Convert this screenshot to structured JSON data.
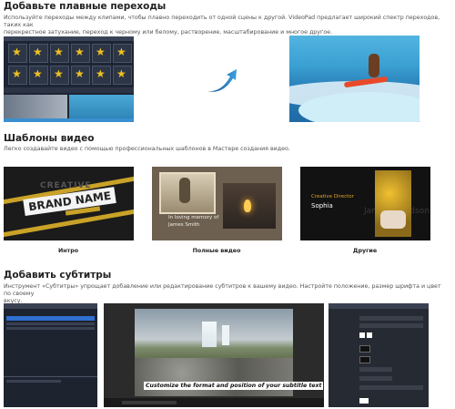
{
  "sections": [
    {
      "title": "Добавьте плавные переходы",
      "desc_lines": [
        "Используйте переходы между клипами, чтобы плавно переходить от одной сцены к другой. VideoPad предлагает широкий спектр переходов, таких как",
        "перекрестное затухание, переход к черному или белому, растворение, масштабирование и многое другое."
      ]
    },
    {
      "title": "Шаблоны видео",
      "desc_lines": [
        "Легко создавайте видео с помощью профессиональных шаблонов в Мастере создания видео."
      ]
    },
    {
      "title": "Добавить субтитры",
      "desc_lines": [
        "Инструмент «Субтитры» упрощает добавление или редактирование субтитров к вашему видео. Настройте положение, размер шрифта и цвет по своему",
        "вкусу."
      ]
    }
  ],
  "templates": [
    {
      "caption": "Интро",
      "title_text": "BRAND NAME",
      "banner_text": "CREATIVE"
    },
    {
      "caption": "Полные видео",
      "memory_line1": "In loving memory of",
      "memory_line2": "James Smith"
    },
    {
      "caption": "Другие",
      "role": "Creative Director",
      "person": "Sophia",
      "ghost": "James Davidson"
    }
  ],
  "subtitle_example": "Customize the format and position of your subtitle text",
  "colors": {
    "accent_yellow": "#f0c020",
    "dark_panel": "#1d2535"
  }
}
